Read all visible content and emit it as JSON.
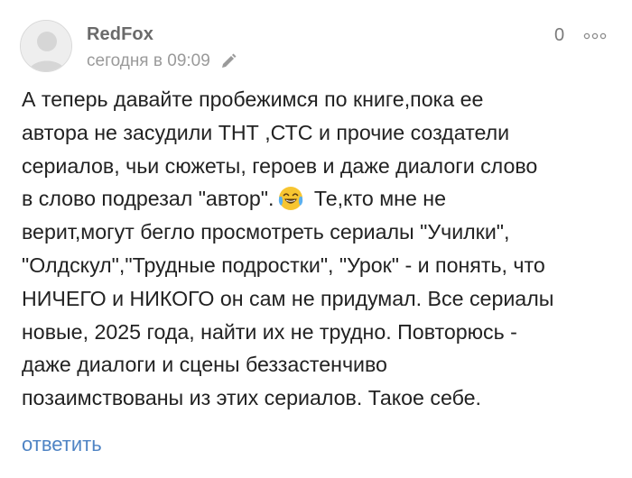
{
  "comment": {
    "author": "RedFox",
    "timestamp": "сегодня в 09:09",
    "rating": "0",
    "avatar_icon": "default-user-avatar",
    "edit_icon": "pencil-icon",
    "more_icon": "more-dots-icon",
    "emoji_icon": "laughing-tears-emoji",
    "body_lines": [
      "А теперь давайте пробежимся по книге,пока ее",
      "автора не засудили ТНТ ,СТС и прочие создатели",
      "сериалов, чьи сюжеты, героев и даже диалоги слово",
      "в слово подрезал \"автор\".",
      " Те,кто мне не",
      "верит,могут бегло просмотреть сериалы \"Училки\",",
      "\"Олдскул\",\"Трудные подростки\", \"Урок\" - и понять, что",
      "НИЧЕГО и НИКОГО он сам не придумал. Все сериалы",
      "новые, 2025 года, найти их не трудно. Повторюсь -",
      "даже диалоги и сцены беззастенчиво",
      "позаимствованы из этих сериалов. Такое себе."
    ],
    "reply_label": "ответить"
  },
  "colors": {
    "author": "#6a6a6a",
    "meta": "#9a9a9a",
    "text": "#222222",
    "link": "#4f84c4",
    "emoji": "#f7c531"
  }
}
